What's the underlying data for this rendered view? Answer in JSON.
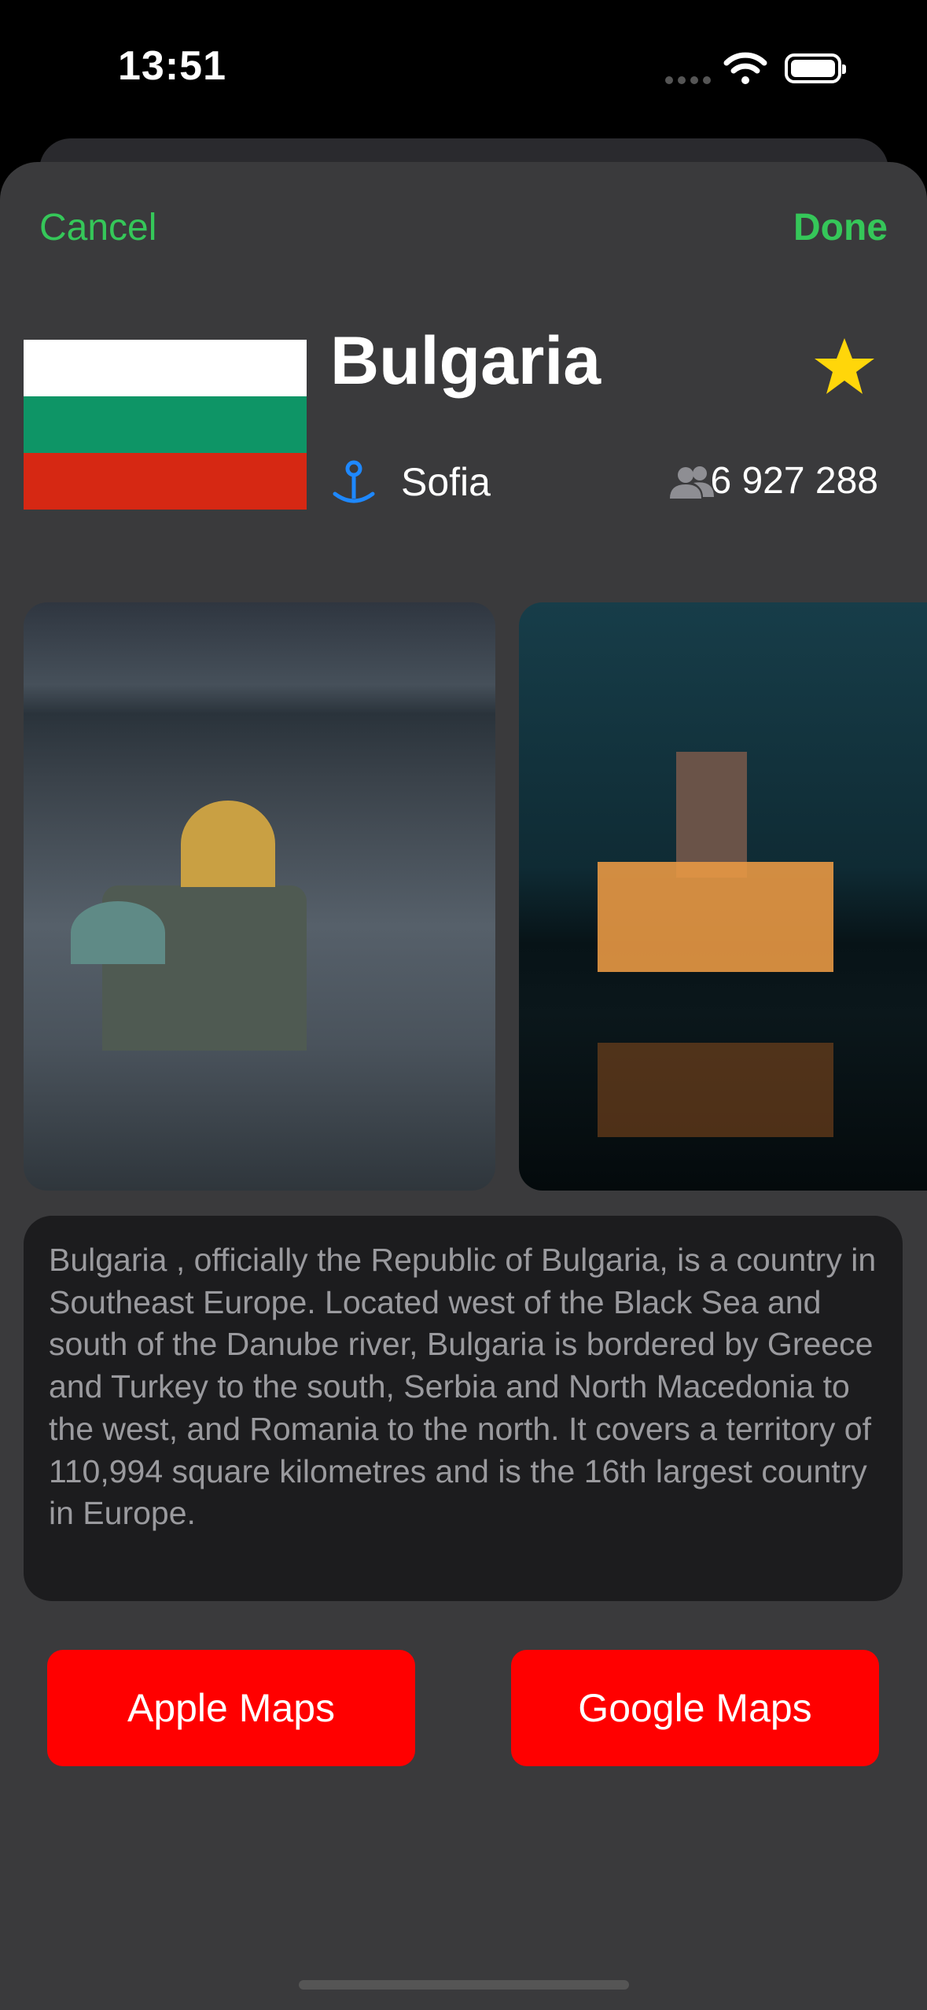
{
  "status_bar": {
    "time": "13:51"
  },
  "nav": {
    "cancel_label": "Cancel",
    "done_label": "Done",
    "accent_color": "#35c759"
  },
  "country": {
    "name": "Bulgaria",
    "capital": "Sofia",
    "population": "6 927 288",
    "flag_colors": [
      "#ffffff",
      "#0e9566",
      "#d62813"
    ],
    "favorite_icon": "star-icon",
    "capital_icon": "map-pin-icon",
    "population_icon": "people-icon"
  },
  "photos": [
    {
      "name": "cathedral-photo"
    },
    {
      "name": "palace-night-photo"
    }
  ],
  "description": "Bulgaria , officially the Republic of Bulgaria, is a country in Southeast Europe. Located west of the Black Sea and south of the Danube river, Bulgaria is bordered by Greece and Turkey to the south, Serbia and North Macedonia to the west, and Romania to the north. It covers a territory of 110,994 square kilometres  and is the 16th largest country in Europe.",
  "buttons": {
    "apple_maps": "Apple Maps",
    "google_maps": "Google Maps",
    "color": "#ff0000"
  }
}
